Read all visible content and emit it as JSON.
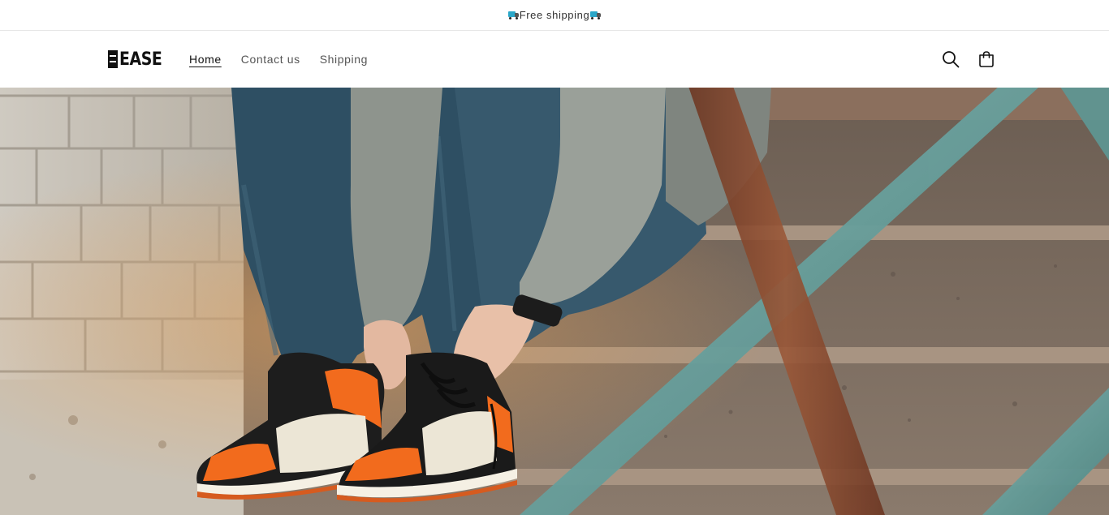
{
  "announcement": {
    "text": "Free shipping",
    "icon": "truck-icon"
  },
  "header": {
    "logo_text": "EASE",
    "nav": [
      {
        "label": "Home",
        "active": true
      },
      {
        "label": "Contact us",
        "active": false
      },
      {
        "label": "Shipping",
        "active": false
      }
    ],
    "icons": [
      "search-icon",
      "cart-icon"
    ]
  },
  "colors": {
    "accent_blue": "#2aa7c9",
    "text": "#121212",
    "nav_text": "#555555",
    "brick": "#d9d5cc",
    "railing_teal": "#6fa3a0",
    "railing_rust": "#8a4a2e",
    "sneaker_orange": "#f26b1d"
  }
}
